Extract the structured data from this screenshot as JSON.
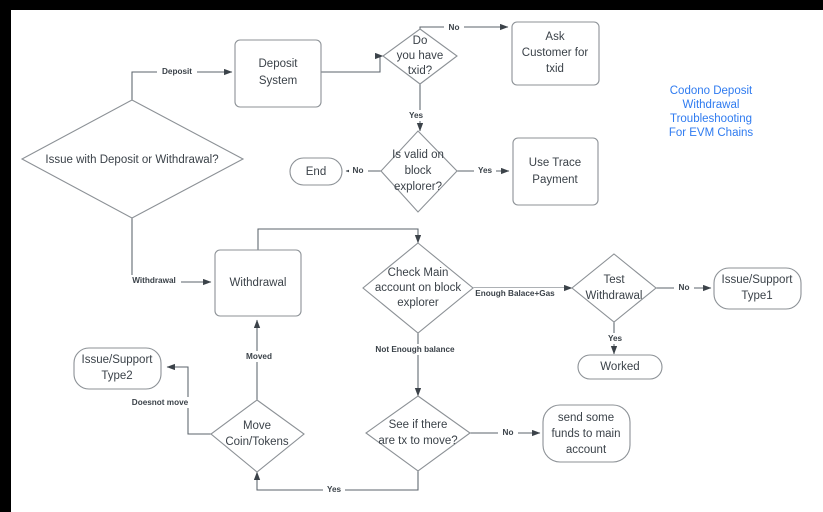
{
  "diagram": {
    "title_lines": [
      "Codono Deposit",
      "Withdrawal",
      "Troubleshooting",
      "For EVM Chains"
    ],
    "title_color": "#2f7bf0",
    "background": "#ffffff",
    "frame_color": "#000000",
    "stroke_color": "#8c9196",
    "text_color": "#3b4249",
    "nodes": {
      "issue_with": {
        "label": "Issue with Deposit or Withdrawal?",
        "shape": "diamond"
      },
      "deposit_system": {
        "line1": "Deposit",
        "line2": "System",
        "shape": "rect"
      },
      "do_you_have_txid": {
        "line1": "Do",
        "line2": "you have",
        "line3": "txid?",
        "shape": "diamond"
      },
      "ask_customer": {
        "line1": "Ask",
        "line2": "Customer for",
        "line3": "txid",
        "shape": "rect"
      },
      "is_valid": {
        "line1": "Is valid on",
        "line2": "block",
        "line3": "explorer?",
        "shape": "diamond"
      },
      "end": {
        "label": "End",
        "shape": "pill"
      },
      "use_trace": {
        "line1": "Use Trace",
        "line2": "Payment",
        "shape": "rect"
      },
      "withdrawal": {
        "label": "Withdrawal",
        "shape": "rect"
      },
      "check_main": {
        "line1": "Check Main",
        "line2": "account on block",
        "line3": "explorer",
        "shape": "diamond"
      },
      "test_withdrawal": {
        "line1": "Test",
        "line2": "Withdrawal",
        "shape": "diamond"
      },
      "issue_support_1": {
        "line1": "Issue/Support",
        "line2": "Type1",
        "shape": "pill"
      },
      "worked": {
        "label": "Worked",
        "shape": "pill"
      },
      "issue_support_2": {
        "line1": "Issue/Support",
        "line2": "Type2",
        "shape": "pill"
      },
      "move_coin_tokens": {
        "line1": "Move",
        "line2": "Coin/Tokens",
        "shape": "diamond"
      },
      "see_if_tx": {
        "line1": "See if there",
        "line2": "are tx to move?",
        "shape": "diamond"
      },
      "send_funds": {
        "line1": "send some",
        "line2": "funds to main",
        "line3": "account",
        "shape": "pill"
      }
    },
    "edge_labels": {
      "deposit": "Deposit",
      "withdrawal": "Withdrawal",
      "txid_no": "No",
      "txid_yes": "Yes",
      "valid_no": "No",
      "valid_yes": "Yes",
      "enough_balance": "Enough Balace+Gas",
      "not_enough_balance": "Not Enough balance",
      "test_no": "No",
      "test_yes": "Yes",
      "moved": "Moved",
      "doesnot_move": "Doesnot move",
      "see_tx_no": "No",
      "see_tx_yes": "Yes"
    }
  }
}
